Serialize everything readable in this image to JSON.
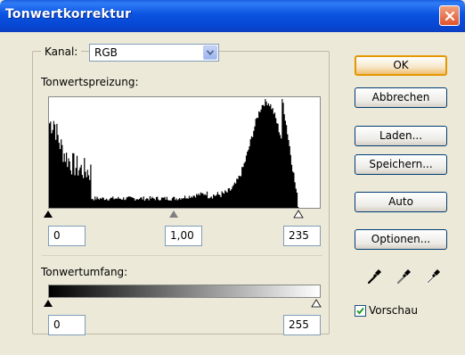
{
  "window": {
    "title": "Tonwertkorrektur"
  },
  "channel": {
    "label": "Kanal:",
    "value": "RGB"
  },
  "input_levels": {
    "label": "Tonwertspreizung:",
    "black": "0",
    "gamma": "1,00",
    "white": "235",
    "black_slider": 0,
    "gamma_slider": 1.0,
    "white_slider": 235
  },
  "output_levels": {
    "label": "Tonwertumfang:",
    "black": "0",
    "white": "255"
  },
  "buttons": {
    "ok": "OK",
    "cancel": "Abbrechen",
    "load": "Laden...",
    "save": "Speichern...",
    "auto": "Auto",
    "options": "Optionen..."
  },
  "preview": {
    "label": "Vorschau",
    "checked": true
  },
  "eyedroppers": [
    "black-point-eyedropper-icon",
    "gray-point-eyedropper-icon",
    "white-point-eyedropper-icon"
  ],
  "colors": {
    "title_bar": "#0a53e0",
    "dialog_bg": "#ece9d8",
    "default_button_border": "#e59700",
    "close_button": "#e0532c"
  }
}
